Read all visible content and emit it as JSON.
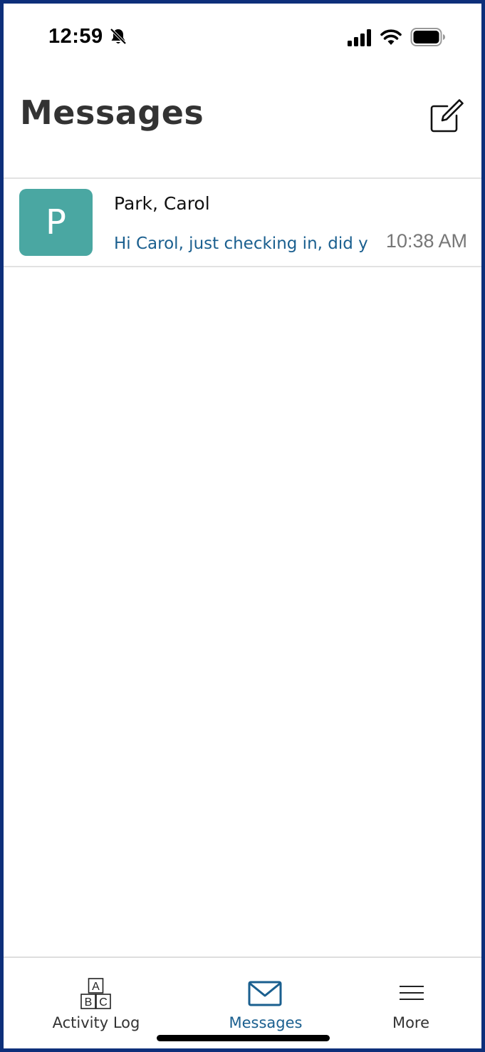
{
  "status_bar": {
    "time": "12:59",
    "icons": [
      "bell-off-icon",
      "signal-icon",
      "wifi-icon",
      "battery-icon"
    ]
  },
  "header": {
    "title": "Messages",
    "compose_icon": "compose-icon"
  },
  "messages": [
    {
      "avatar_letter": "P",
      "avatar_color": "#4aa7a2",
      "sender": "Park, Carol",
      "preview": "Hi Carol, just checking in, did y",
      "time": "10:38 AM"
    }
  ],
  "tab_bar": {
    "tabs": [
      {
        "label": "Activity Log",
        "icon": "abc-blocks-icon",
        "active": false
      },
      {
        "label": "Messages",
        "icon": "envelope-icon",
        "active": true
      },
      {
        "label": "More",
        "icon": "hamburger-menu-icon",
        "active": false
      }
    ],
    "abc_block_letters": [
      "A",
      "B",
      "C"
    ]
  },
  "colors": {
    "frame_border": "#0d2f7a",
    "accent": "#1a5f8f",
    "preview_text": "#1a5f8f",
    "inactive_tab": "#333333"
  }
}
